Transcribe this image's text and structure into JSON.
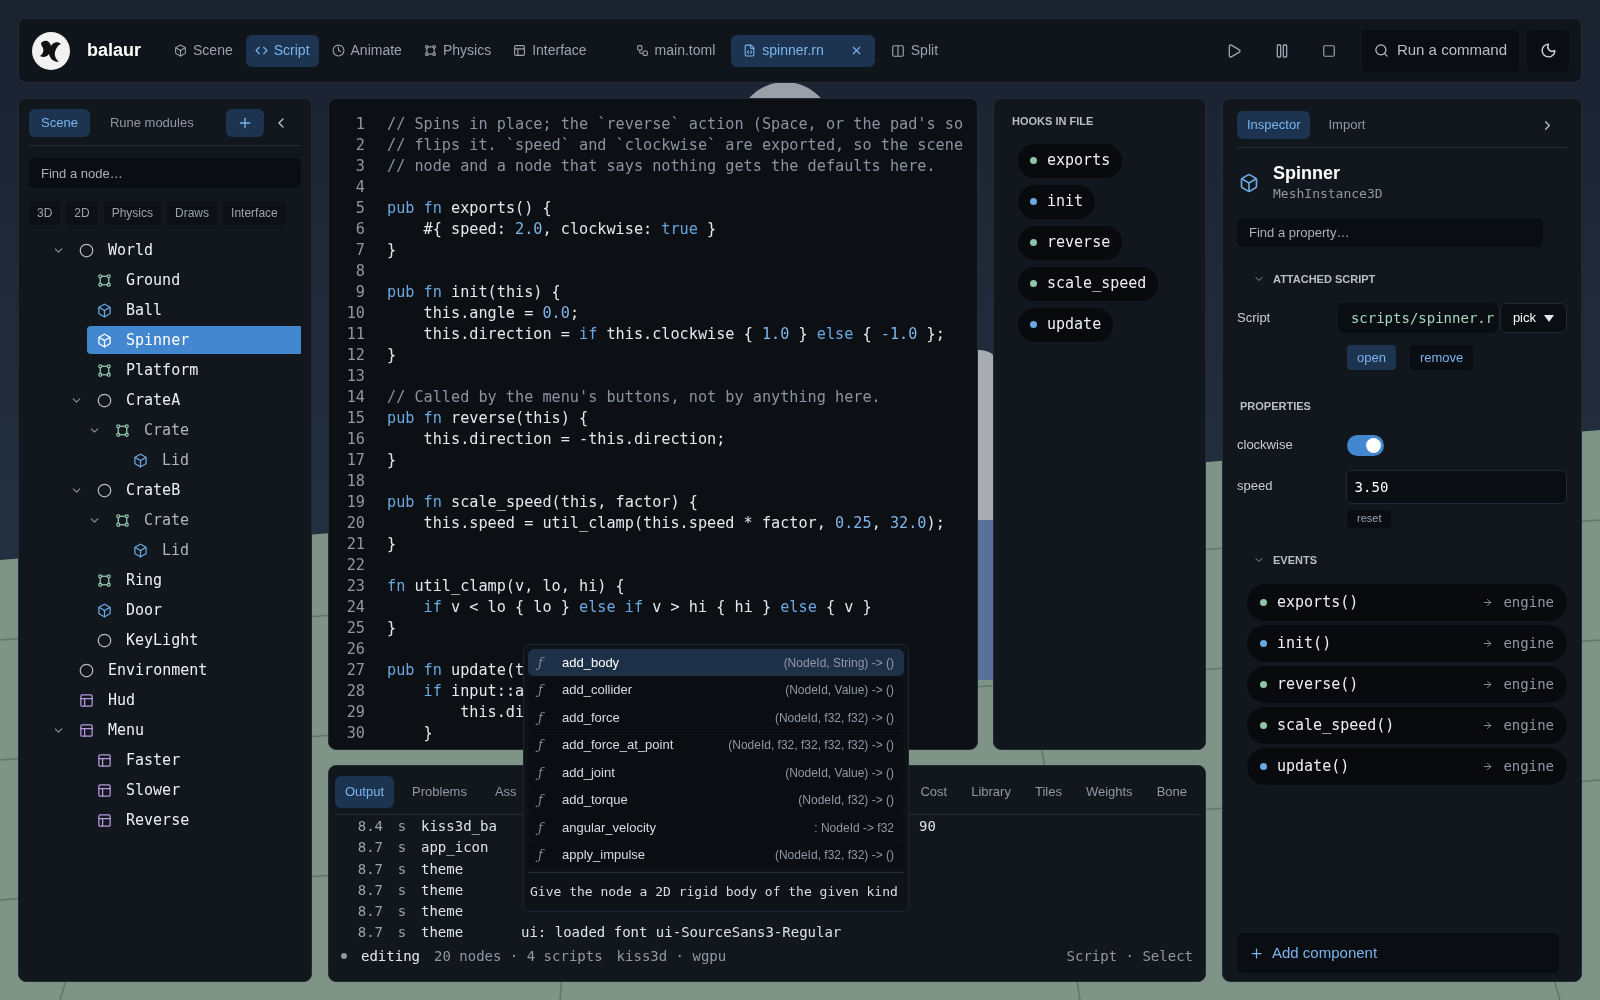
{
  "topbar": {
    "app_name": "balaur",
    "modes": [
      {
        "label": "Scene",
        "kind": "cube",
        "selected": false
      },
      {
        "label": "Script",
        "kind": "code",
        "selected": true
      },
      {
        "label": "Animate",
        "kind": "clock",
        "selected": false
      },
      {
        "label": "Physics",
        "kind": "frame",
        "selected": false
      },
      {
        "label": "Interface",
        "kind": "layout",
        "selected": false
      }
    ],
    "files": [
      {
        "label": "main.toml",
        "kind": "nodes",
        "selected": false,
        "closable": false
      },
      {
        "label": "spinner.rn",
        "kind": "file",
        "selected": true,
        "closable": true
      }
    ],
    "split": "Split",
    "command": "Run a command"
  },
  "left": {
    "tabs": [
      {
        "label": "Scene",
        "selected": true
      },
      {
        "label": "Rune modules",
        "selected": false
      }
    ],
    "search": {
      "placeholder": "Find a node…"
    },
    "filters": [
      "3D",
      "2D",
      "Physics",
      "Draws",
      "Interface"
    ],
    "tree": [
      {
        "name": "World",
        "kind": "circle",
        "expanded": true,
        "selected": false,
        "disabled": false,
        "children": [
          {
            "name": "Ground",
            "kind": "frame",
            "selected": false,
            "disabled": false
          },
          {
            "name": "Ball",
            "kind": "cube",
            "selected": false,
            "disabled": false
          },
          {
            "name": "Spinner",
            "kind": "cube",
            "selected": true,
            "disabled": false
          },
          {
            "name": "Platform",
            "kind": "frame",
            "selected": false,
            "disabled": false
          },
          {
            "name": "CrateA",
            "kind": "circle",
            "expanded": true,
            "selected": false,
            "disabled": false,
            "children": [
              {
                "name": "Crate",
                "kind": "frame",
                "expanded": true,
                "selected": false,
                "disabled": true,
                "children": [
                  {
                    "name": "Lid",
                    "kind": "cube",
                    "selected": false,
                    "disabled": true
                  }
                ]
              }
            ]
          },
          {
            "name": "CrateB",
            "kind": "circle",
            "expanded": true,
            "selected": false,
            "disabled": false,
            "children": [
              {
                "name": "Crate",
                "kind": "frame",
                "expanded": true,
                "selected": false,
                "disabled": true,
                "children": [
                  {
                    "name": "Lid",
                    "kind": "cube",
                    "selected": false,
                    "disabled": true
                  }
                ]
              }
            ]
          },
          {
            "name": "Ring",
            "kind": "frame",
            "selected": false,
            "disabled": false
          },
          {
            "name": "Door",
            "kind": "cube",
            "selected": false,
            "disabled": false
          },
          {
            "name": "KeyLight",
            "kind": "circle",
            "selected": false,
            "disabled": false
          }
        ]
      },
      {
        "name": "Environment",
        "kind": "circle",
        "selected": false,
        "disabled": false
      },
      {
        "name": "Hud",
        "kind": "layout",
        "selected": false,
        "disabled": false
      },
      {
        "name": "Menu",
        "kind": "layout",
        "expanded": true,
        "selected": false,
        "disabled": false,
        "children": [
          {
            "name": "Faster",
            "kind": "layout",
            "selected": false,
            "disabled": false
          },
          {
            "name": "Slower",
            "kind": "layout",
            "selected": false,
            "disabled": false
          },
          {
            "name": "Reverse",
            "kind": "layout",
            "selected": false,
            "disabled": false
          }
        ]
      }
    ]
  },
  "editor": {
    "lines": [
      {
        "n": "1",
        "tokens": [
          {
            "kind": "comment",
            "t": "// Spins in place; the `reverse` action (Space, or the pad's so"
          }
        ]
      },
      {
        "n": "2",
        "tokens": [
          {
            "kind": "comment",
            "t": "// flips it. `speed` and `clockwise` are exported, so the scene"
          }
        ]
      },
      {
        "n": "3",
        "tokens": [
          {
            "kind": "comment",
            "t": "// node and a node that says nothing gets the defaults here."
          }
        ]
      },
      {
        "n": "4"
      },
      {
        "n": "5",
        "tokens": [
          {
            "kind": "keyword",
            "t": "pub fn "
          },
          {
            "kind": "plain",
            "t": "exports() {"
          }
        ]
      },
      {
        "n": "6",
        "tokens": [
          {
            "kind": "plain",
            "t": "    #{ speed: "
          },
          {
            "kind": "number",
            "t": "2.0"
          },
          {
            "kind": "plain",
            "t": ", clockwise: "
          },
          {
            "kind": "keyword",
            "t": "true"
          },
          {
            "kind": "plain",
            "t": " }"
          }
        ]
      },
      {
        "n": "7",
        "tokens": [
          {
            "kind": "plain",
            "t": "}"
          }
        ]
      },
      {
        "n": "8"
      },
      {
        "n": "9",
        "tokens": [
          {
            "kind": "keyword",
            "t": "pub fn "
          },
          {
            "kind": "plain",
            "t": "init(this) {"
          }
        ]
      },
      {
        "n": "10",
        "tokens": [
          {
            "kind": "plain",
            "t": "    this.angle = "
          },
          {
            "kind": "number",
            "t": "0.0"
          },
          {
            "kind": "plain",
            "t": ";"
          }
        ]
      },
      {
        "n": "11",
        "tokens": [
          {
            "kind": "plain",
            "t": "    this.direction = "
          },
          {
            "kind": "keyword",
            "t": "if"
          },
          {
            "kind": "plain",
            "t": " this.clockwise { "
          },
          {
            "kind": "number",
            "t": "1.0"
          },
          {
            "kind": "plain",
            "t": " } "
          },
          {
            "kind": "keyword",
            "t": "else"
          },
          {
            "kind": "plain",
            "t": " { "
          },
          {
            "kind": "number",
            "t": "-1.0"
          },
          {
            "kind": "plain",
            "t": " };"
          }
        ]
      },
      {
        "n": "12",
        "tokens": [
          {
            "kind": "plain",
            "t": "}"
          }
        ]
      },
      {
        "n": "13"
      },
      {
        "n": "14",
        "tokens": [
          {
            "kind": "comment",
            "t": "// Called by the menu's buttons, not by anything here."
          }
        ]
      },
      {
        "n": "15",
        "tokens": [
          {
            "kind": "keyword",
            "t": "pub fn "
          },
          {
            "kind": "plain",
            "t": "reverse(this) {"
          }
        ]
      },
      {
        "n": "16",
        "tokens": [
          {
            "kind": "plain",
            "t": "    this.direction = -this.direction;"
          }
        ]
      },
      {
        "n": "17",
        "tokens": [
          {
            "kind": "plain",
            "t": "}"
          }
        ]
      },
      {
        "n": "18"
      },
      {
        "n": "19",
        "tokens": [
          {
            "kind": "keyword",
            "t": "pub fn "
          },
          {
            "kind": "plain",
            "t": "scale_speed(this, factor) {"
          }
        ]
      },
      {
        "n": "20",
        "tokens": [
          {
            "kind": "plain",
            "t": "    this.speed = util_clamp(this.speed * factor, "
          },
          {
            "kind": "number",
            "t": "0.25"
          },
          {
            "kind": "plain",
            "t": ", "
          },
          {
            "kind": "number",
            "t": "32.0"
          },
          {
            "kind": "plain",
            "t": ");"
          }
        ]
      },
      {
        "n": "21",
        "tokens": [
          {
            "kind": "plain",
            "t": "}"
          }
        ]
      },
      {
        "n": "22"
      },
      {
        "n": "23",
        "tokens": [
          {
            "kind": "keyword",
            "t": "fn "
          },
          {
            "kind": "plain",
            "t": "util_clamp(v, lo, hi) {"
          }
        ]
      },
      {
        "n": "24",
        "tokens": [
          {
            "kind": "keyword",
            "t": "    if"
          },
          {
            "kind": "plain",
            "t": " v < lo { lo } "
          },
          {
            "kind": "keyword",
            "t": "else if"
          },
          {
            "kind": "plain",
            "t": " v > hi { hi } "
          },
          {
            "kind": "keyword",
            "t": "else"
          },
          {
            "kind": "plain",
            "t": " { v }"
          }
        ]
      },
      {
        "n": "25",
        "tokens": [
          {
            "kind": "plain",
            "t": "}"
          }
        ]
      },
      {
        "n": "26"
      },
      {
        "n": "27",
        "tokens": [
          {
            "kind": "keyword",
            "t": "pub fn "
          },
          {
            "kind": "plain",
            "t": "update(t"
          }
        ]
      },
      {
        "n": "28",
        "tokens": [
          {
            "kind": "keyword",
            "t": "    if"
          },
          {
            "kind": "plain",
            "t": " input::a"
          }
        ]
      },
      {
        "n": "29",
        "tokens": [
          {
            "kind": "plain",
            "t": "        this.di"
          }
        ]
      },
      {
        "n": "30",
        "tokens": [
          {
            "kind": "plain",
            "t": "    }"
          }
        ]
      }
    ]
  },
  "hooks": {
    "title": "HOOKS IN FILE",
    "items": [
      {
        "name": "exports",
        "color": "#8fc4a8"
      },
      {
        "name": "init",
        "color": "#6aa8e0"
      },
      {
        "name": "reverse",
        "color": "#8fc4a8"
      },
      {
        "name": "scale_speed",
        "color": "#8fc4a8"
      },
      {
        "name": "update",
        "color": "#6aa8e0"
      }
    ]
  },
  "completion": {
    "items": [
      {
        "glyph": "ƒ",
        "name": "add_body",
        "signature": "(NodeId, String) -> ()",
        "selected": true
      },
      {
        "glyph": "ƒ",
        "name": "add_collider",
        "signature": "(NodeId, Value) -> ()",
        "selected": false
      },
      {
        "glyph": "ƒ",
        "name": "add_force",
        "signature": "(NodeId, f32, f32) -> ()",
        "selected": false
      },
      {
        "glyph": "ƒ",
        "name": "add_force_at_point",
        "signature": "(NodeId, f32, f32, f32, f32) -> ()",
        "selected": false
      },
      {
        "glyph": "ƒ",
        "name": "add_joint",
        "signature": "(NodeId, Value) -> ()",
        "selected": false
      },
      {
        "glyph": "ƒ",
        "name": "add_torque",
        "signature": "(NodeId, f32) -> ()",
        "selected": false
      },
      {
        "glyph": "ƒ",
        "name": "angular_velocity",
        "signature": ": NodeId -> f32",
        "selected": false
      },
      {
        "glyph": "ƒ",
        "name": "apply_impulse",
        "signature": "(NodeId, f32, f32) -> ()",
        "selected": false
      }
    ],
    "doc": "Give the node a 2D rigid body of the given kind"
  },
  "output": {
    "tabs": [
      {
        "label": "Output",
        "selected": true
      },
      {
        "label": "Problems",
        "selected": false
      },
      {
        "label": "Ass",
        "selected": false
      }
    ],
    "more_tabs": [
      {
        "label": "Cost",
        "selected": false
      },
      {
        "label": "Library",
        "selected": false
      },
      {
        "label": "Tiles",
        "selected": false
      },
      {
        "label": "Weights",
        "selected": false
      },
      {
        "label": "Bone",
        "selected": false
      }
    ],
    "rows": [
      {
        "time": "8.4",
        "unit": "s",
        "source": "kiss3d_ba",
        "trailing": "90"
      },
      {
        "time": "8.7",
        "unit": "s",
        "source": "app_icon"
      },
      {
        "time": "8.7",
        "unit": "s",
        "source": "theme"
      },
      {
        "time": "8.7",
        "unit": "s",
        "source": "theme"
      },
      {
        "time": "8.7",
        "unit": "s",
        "source": "theme"
      },
      {
        "time": "8.7",
        "unit": "s",
        "source": "theme",
        "message": "ui: loaded font ui-SourceSans3-Regular"
      }
    ],
    "status": {
      "state": "editing",
      "counts": "20 nodes · 4 scripts",
      "backend": "kiss3d · wgpu",
      "mode": "Script · Select"
    }
  },
  "inspector": {
    "tabs": [
      {
        "label": "Inspector",
        "selected": true
      },
      {
        "label": "Import",
        "selected": false
      }
    ],
    "node": {
      "name": "Spinner",
      "type": "MeshInstance3D"
    },
    "search": {
      "placeholder": "Find a property…"
    },
    "attached_script": {
      "title": "ATTACHED SCRIPT",
      "expanded": true,
      "label": "Script",
      "value": "scripts/spinner.r",
      "pick": "pick",
      "actions": [
        {
          "label": "open",
          "primary": true
        },
        {
          "label": "remove",
          "primary": false
        }
      ]
    },
    "properties": {
      "title": "PROPERTIES",
      "items": [
        {
          "kind": "toggle",
          "label": "clockwise",
          "on": true
        },
        {
          "kind": "number",
          "label": "speed",
          "value": "3.50",
          "reset": "reset"
        }
      ]
    },
    "events": {
      "title": "EVENTS",
      "expanded": true,
      "items": [
        {
          "name": "exports()",
          "target": "engine",
          "color": "#8fc4a8"
        },
        {
          "name": "init()",
          "target": "engine",
          "color": "#6aa8e0"
        },
        {
          "name": "reverse()",
          "target": "engine",
          "color": "#8fc4a8"
        },
        {
          "name": "scale_speed()",
          "target": "engine",
          "color": "#8fc4a8"
        },
        {
          "name": "update()",
          "target": "engine",
          "color": "#6aa8e0"
        }
      ]
    },
    "add_component": "Add component"
  }
}
